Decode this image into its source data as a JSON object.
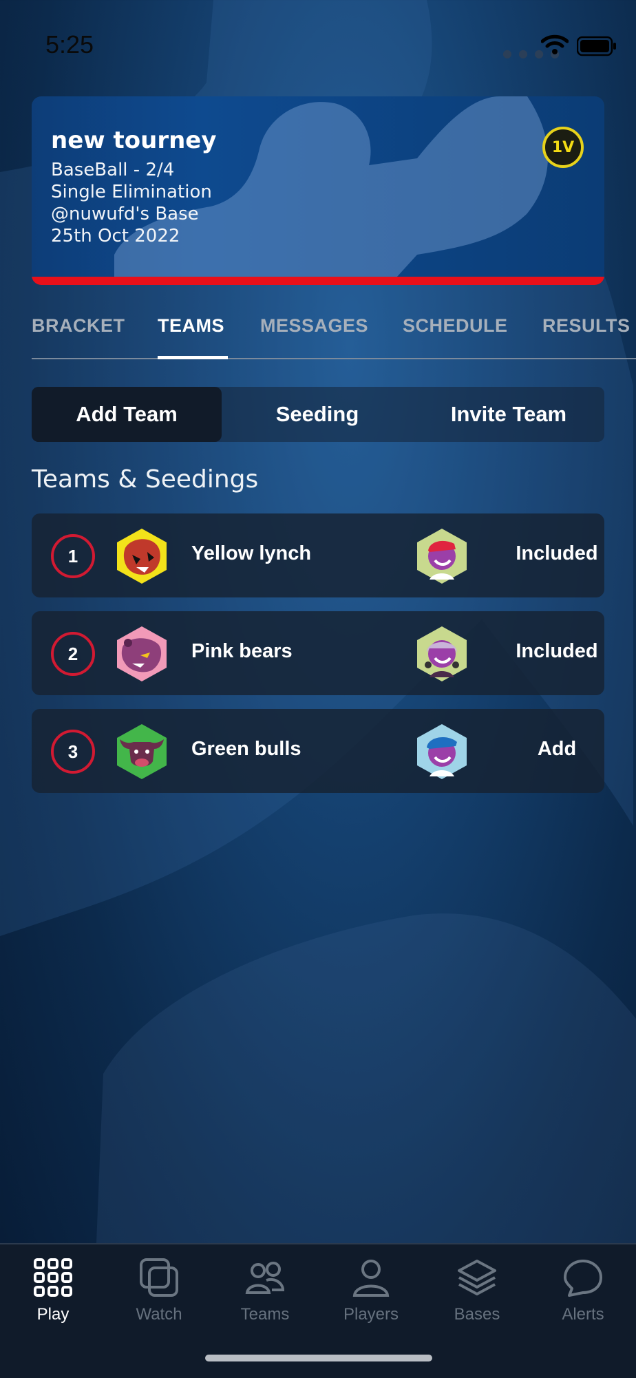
{
  "status_bar": {
    "time": "5:25"
  },
  "tournament": {
    "title": "new tourney",
    "sport_line": "BaseBall - 2/4",
    "format": "Single Elimination",
    "venue": "@nuwufd's Base",
    "date": "25th Oct 2022",
    "badge": "1V"
  },
  "tabs": [
    {
      "label": "BRACKET",
      "active": false
    },
    {
      "label": "TEAMS",
      "active": true
    },
    {
      "label": "MESSAGES",
      "active": false
    },
    {
      "label": "SCHEDULE",
      "active": false
    },
    {
      "label": "RESULTS",
      "active": false
    }
  ],
  "segments": [
    {
      "label": "Add Team",
      "active": true
    },
    {
      "label": "Seeding",
      "active": false
    },
    {
      "label": "Invite Team",
      "active": false
    }
  ],
  "section_title": "Teams & Seedings",
  "teams": [
    {
      "seed": "1",
      "name": "Yellow lynch",
      "status": "Included",
      "logo_color": "#f3e21a",
      "logo_icon": "tiger-icon",
      "avatar_bg": "#c8d98e"
    },
    {
      "seed": "2",
      "name": "Pink bears",
      "status": "Included",
      "logo_color": "#f29ab8",
      "logo_icon": "bear-icon",
      "avatar_bg": "#c8d98e"
    },
    {
      "seed": "3",
      "name": "Green bulls",
      "status": "Add",
      "logo_color": "#43b64a",
      "logo_icon": "bull-icon",
      "avatar_bg": "#9fd4e8"
    }
  ],
  "tabbar": [
    {
      "label": "Play",
      "icon": "grid-icon",
      "active": true
    },
    {
      "label": "Watch",
      "icon": "watch-icon",
      "active": false
    },
    {
      "label": "Teams",
      "icon": "people-icon",
      "active": false
    },
    {
      "label": "Players",
      "icon": "person-icon",
      "active": false
    },
    {
      "label": "Bases",
      "icon": "layers-icon",
      "active": false
    },
    {
      "label": "Alerts",
      "icon": "chat-bubble-icon",
      "active": false
    }
  ],
  "colors": {
    "accent_red": "#d21a32",
    "badge_yellow": "#e7d21b",
    "banner_blue": "#0e4a8f"
  }
}
